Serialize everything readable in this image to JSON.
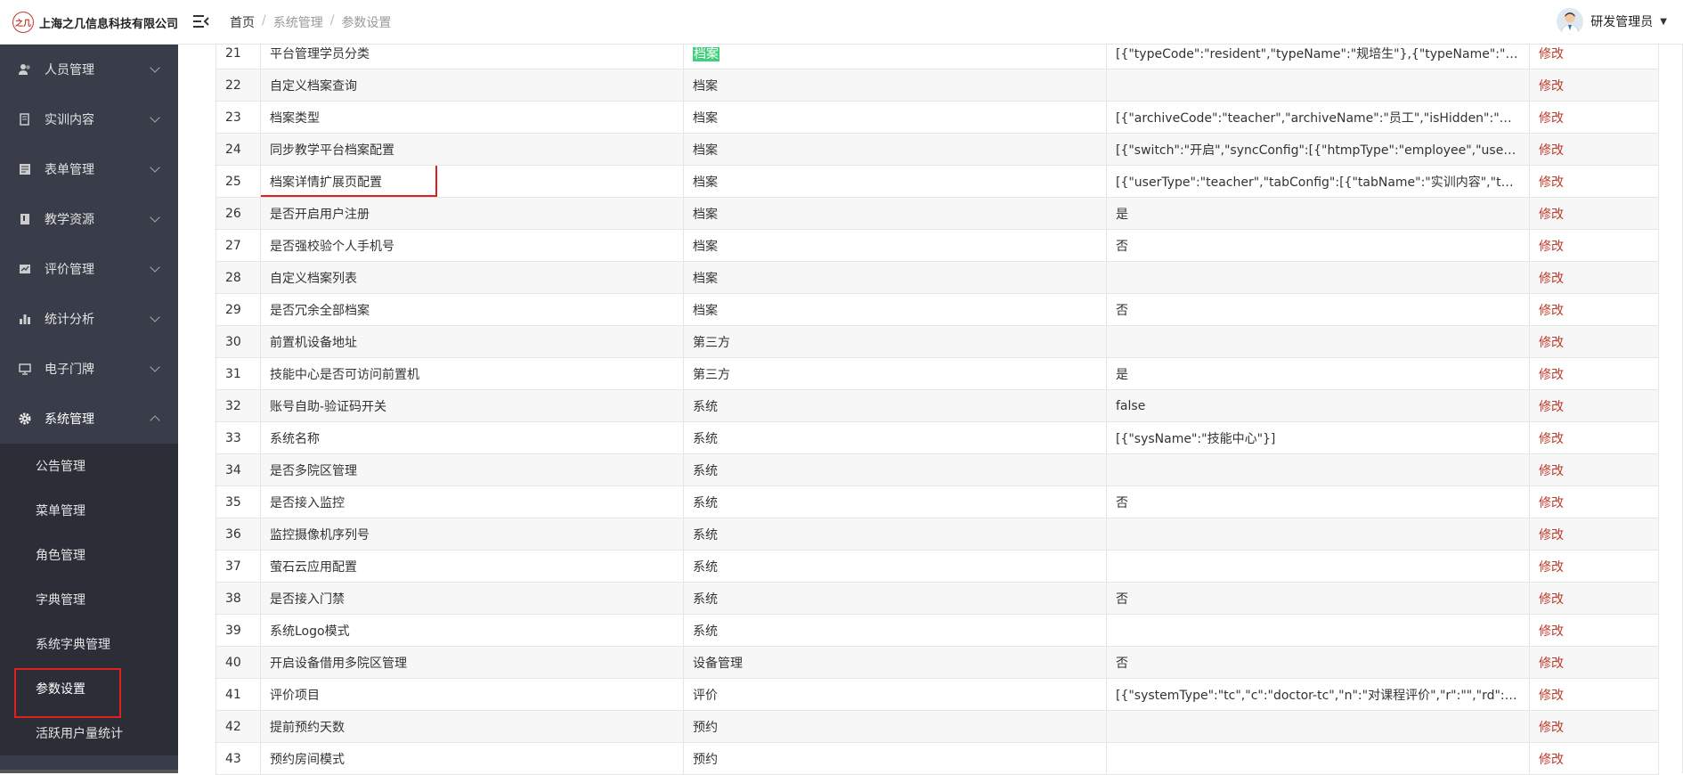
{
  "header": {
    "logo_mark": "之几",
    "logo_text": "上海之几信息科技有限公司",
    "breadcrumb": [
      "首页",
      "系统管理",
      "参数设置"
    ],
    "breadcrumb_sep": "/",
    "user_name": "研发管理员",
    "caret": "▼"
  },
  "sidebar": {
    "items": [
      {
        "label": "人员管理",
        "icon": "users-icon"
      },
      {
        "label": "实训内容",
        "icon": "book-icon"
      },
      {
        "label": "表单管理",
        "icon": "form-icon"
      },
      {
        "label": "教学资源",
        "icon": "resource-icon"
      },
      {
        "label": "评价管理",
        "icon": "evaluation-icon"
      },
      {
        "label": "统计分析",
        "icon": "bar-chart-icon"
      },
      {
        "label": "电子门牌",
        "icon": "monitor-icon"
      },
      {
        "label": "系统管理",
        "icon": "gear-icon"
      }
    ],
    "sub_items": [
      "公告管理",
      "菜单管理",
      "角色管理",
      "字典管理",
      "系统字典管理",
      "参数设置",
      "活跃用户量统计"
    ]
  },
  "table": {
    "edit_label": "修改",
    "rows": [
      {
        "id": "21",
        "name": "平台管理学员分类",
        "category": "档案",
        "value": "[{\"typeCode\":\"resident\",\"typeName\":\"规培生\"},{\"typeName\":\"实习生\",\"t..."
      },
      {
        "id": "22",
        "name": "自定义档案查询",
        "category": "档案",
        "value": ""
      },
      {
        "id": "23",
        "name": "档案类型",
        "category": "档案",
        "value": "[{\"archiveCode\":\"teacher\",\"archiveName\":\"员工\",\"isHidden\":\"否\",\"regist..."
      },
      {
        "id": "24",
        "name": "同步教学平台档案配置",
        "category": "档案",
        "value": "[{\"switch\":\"开启\",\"syncConfig\":[{\"htmpType\":\"employee\",\"userType\":\"te..."
      },
      {
        "id": "25",
        "name": "档案详情扩展页配置",
        "category": "档案",
        "value": "[{\"userType\":\"teacher\",\"tabConfig\":[{\"tabName\":\"实训内容\",\"tabPath\":\"..."
      },
      {
        "id": "26",
        "name": "是否开启用户注册",
        "category": "档案",
        "value": "是"
      },
      {
        "id": "27",
        "name": "是否强校验个人手机号",
        "category": "档案",
        "value": "否"
      },
      {
        "id": "28",
        "name": "自定义档案列表",
        "category": "档案",
        "value": ""
      },
      {
        "id": "29",
        "name": "是否冗余全部档案",
        "category": "档案",
        "value": "否"
      },
      {
        "id": "30",
        "name": "前置机设备地址",
        "category": "第三方",
        "value": ""
      },
      {
        "id": "31",
        "name": "技能中心是否可访问前置机",
        "category": "第三方",
        "value": "是"
      },
      {
        "id": "32",
        "name": "账号自助-验证码开关",
        "category": "系统",
        "value": "false"
      },
      {
        "id": "33",
        "name": "系统名称",
        "category": "系统",
        "value": "[{\"sysName\":\"技能中心\"}]"
      },
      {
        "id": "34",
        "name": "是否多院区管理",
        "category": "系统",
        "value": ""
      },
      {
        "id": "35",
        "name": "是否接入监控",
        "category": "系统",
        "value": "否"
      },
      {
        "id": "36",
        "name": "监控摄像机序列号",
        "category": "系统",
        "value": ""
      },
      {
        "id": "37",
        "name": "萤石云应用配置",
        "category": "系统",
        "value": ""
      },
      {
        "id": "38",
        "name": "是否接入门禁",
        "category": "系统",
        "value": "否"
      },
      {
        "id": "39",
        "name": "系统Logo模式",
        "category": "系统",
        "value": ""
      },
      {
        "id": "40",
        "name": "开启设备借用多院区管理",
        "category": "设备管理",
        "value": "否"
      },
      {
        "id": "41",
        "name": "评价项目",
        "category": "评价",
        "value": "[{\"systemType\":\"tc\",\"c\":\"doctor-tc\",\"n\":\"对课程评价\",\"r\":\"\",\"rd\":\"\",\"s\":\"Tc..."
      },
      {
        "id": "42",
        "name": "提前预约天数",
        "category": "预约",
        "value": ""
      },
      {
        "id": "43",
        "name": "预约房间模式",
        "category": "预约",
        "value": ""
      }
    ]
  }
}
